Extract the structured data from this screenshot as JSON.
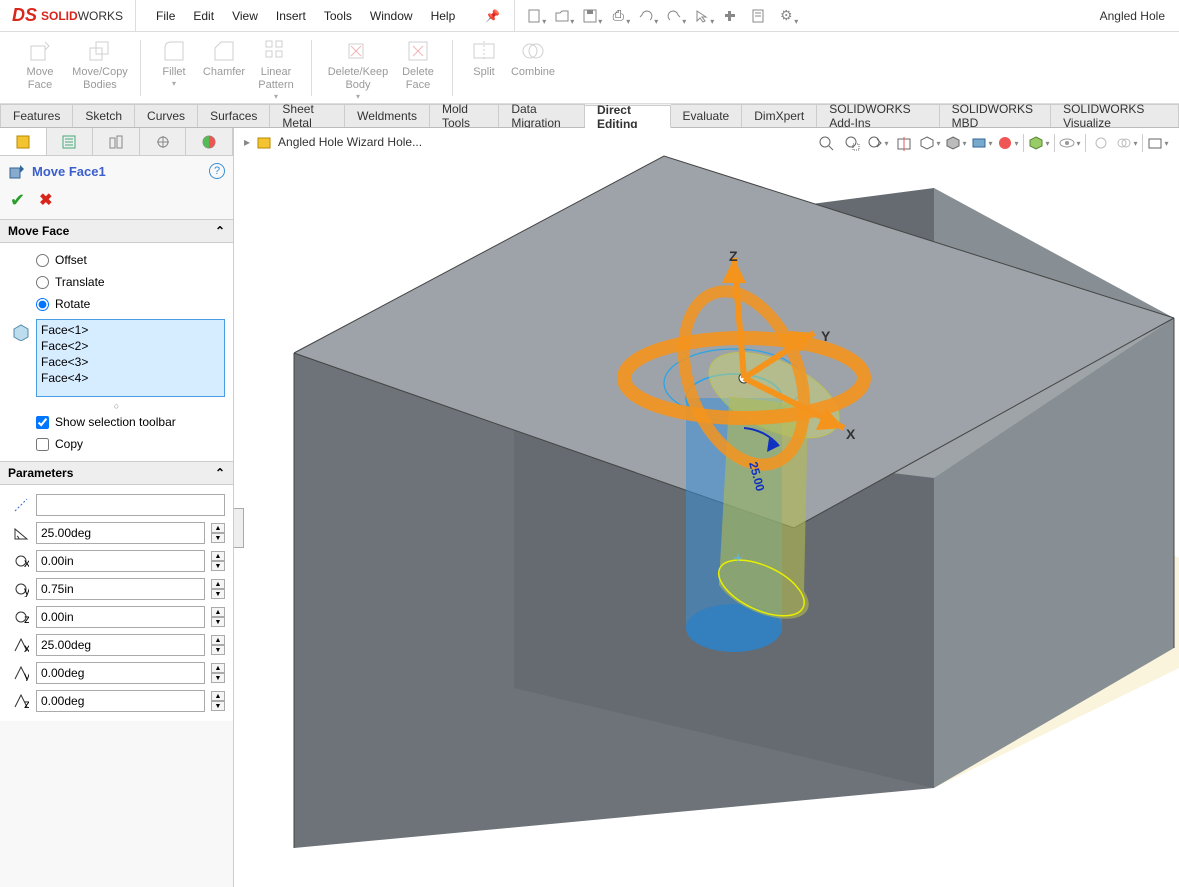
{
  "app": {
    "brand_solid": "SOLID",
    "brand_works": "WORKS",
    "filename": "Angled Hole"
  },
  "menu": [
    "File",
    "Edit",
    "View",
    "Insert",
    "Tools",
    "Window",
    "Help"
  ],
  "ribbon": {
    "move_face": "Move\nFace",
    "move_copy": "Move/Copy\nBodies",
    "fillet": "Fillet",
    "chamfer": "Chamfer",
    "linear_pattern": "Linear\nPattern",
    "delete_keep": "Delete/Keep\nBody",
    "delete_face": "Delete\nFace",
    "split": "Split",
    "combine": "Combine"
  },
  "tabs": [
    "Features",
    "Sketch",
    "Curves",
    "Surfaces",
    "Sheet Metal",
    "Weldments",
    "Mold Tools",
    "Data Migration",
    "Direct Editing",
    "Evaluate",
    "DimXpert",
    "SOLIDWORKS Add-Ins",
    "SOLIDWORKS MBD",
    "SOLIDWORKS Visualize"
  ],
  "tabs_active_index": 8,
  "pm": {
    "title": "Move Face1",
    "move_face_label": "Move Face",
    "options": {
      "offset": "Offset",
      "translate": "Translate",
      "rotate": "Rotate",
      "selected": "rotate"
    },
    "faces": [
      "Face<1>",
      "Face<2>",
      "Face<3>",
      "Face<4>"
    ],
    "show_sel_toolbar": {
      "label": "Show selection toolbar",
      "checked": true
    },
    "copy": {
      "label": "Copy",
      "checked": false
    },
    "parameters_label": "Parameters",
    "params": {
      "ref": "",
      "angle": "25.00deg",
      "cx": "0.00in",
      "cy": "0.75in",
      "cz": "0.00in",
      "rx": "25.00deg",
      "ry": "0.00deg",
      "rz": "0.00deg"
    }
  },
  "breadcrumb": "Angled Hole Wizard Hole...",
  "axes": {
    "x": "X",
    "y": "Y",
    "z": "Z"
  },
  "triad_angle": "25.00"
}
